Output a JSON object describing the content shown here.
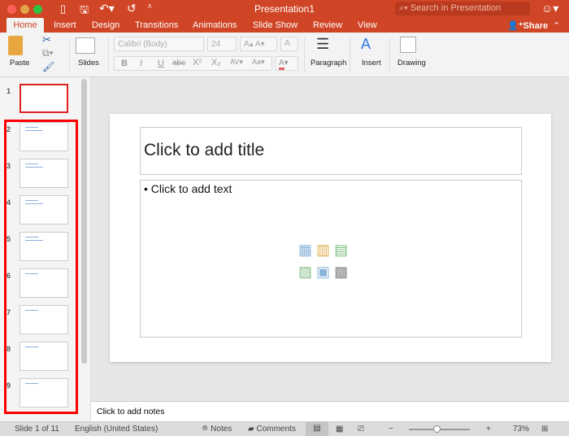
{
  "window": {
    "title": "Presentation1",
    "search_placeholder": "Search in Presentation"
  },
  "tabs": [
    "Home",
    "Insert",
    "Design",
    "Transitions",
    "Animations",
    "Slide Show",
    "Review",
    "View"
  ],
  "share_label": "Share",
  "ribbon": {
    "paste": "Paste",
    "slides": "Slides",
    "font_name": "Calibri (Body)",
    "font_size": "24",
    "paragraph": "Paragraph",
    "insert": "Insert",
    "drawing": "Drawing",
    "bold": "B",
    "italic": "I",
    "underline": "U",
    "strike": "abc"
  },
  "thumbnails": [
    "1",
    "2",
    "3",
    "4",
    "5",
    "6",
    "7",
    "8",
    "9"
  ],
  "slide": {
    "title_placeholder": "Click to add title",
    "body_placeholder": "• Click to add text"
  },
  "notes_placeholder": "Click to add notes",
  "status": {
    "slide_info": "Slide 1 of 11",
    "language": "English (United States)",
    "notes": "Notes",
    "comments": "Comments",
    "zoom": "73%",
    "zoom_fraction": 0.45
  }
}
